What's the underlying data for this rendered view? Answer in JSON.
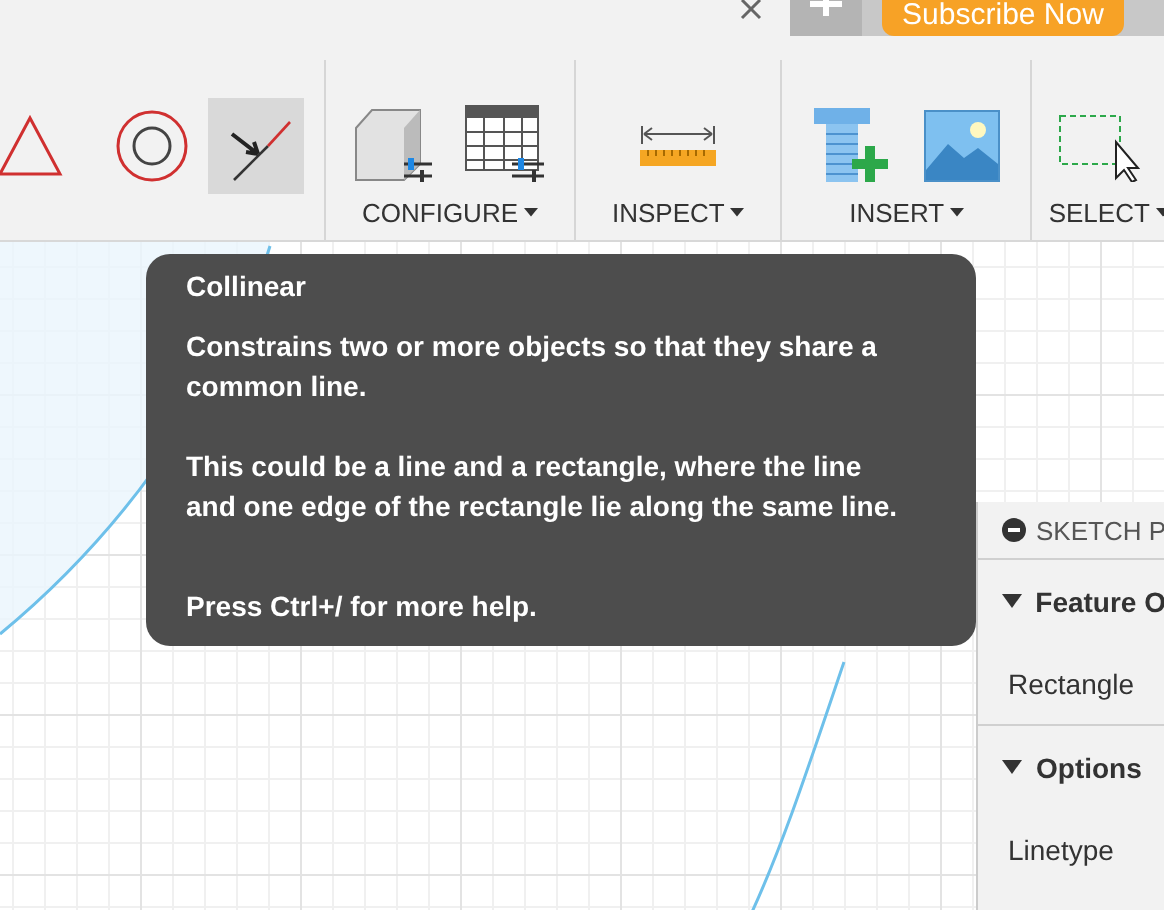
{
  "tab_strip": {
    "subscribe_button": "Subscribe Now"
  },
  "toolbar": {
    "groups": [
      {
        "tools": [
          {
            "kind": "triangle",
            "selected": false
          },
          {
            "kind": "circle",
            "selected": false
          },
          {
            "kind": "collinear",
            "selected": true
          }
        ]
      },
      {
        "label": "CONFIGURE",
        "tools": [
          {
            "kind": "box",
            "selected": false
          },
          {
            "kind": "table",
            "selected": false
          }
        ]
      },
      {
        "label": "INSPECT",
        "tools": [
          {
            "kind": "ruler",
            "selected": false
          }
        ]
      },
      {
        "label": "INSERT",
        "tools": [
          {
            "kind": "bolt",
            "selected": false
          },
          {
            "kind": "image",
            "selected": false
          }
        ]
      },
      {
        "label": "SELECT",
        "tools": [
          {
            "kind": "select",
            "selected": false
          }
        ]
      }
    ]
  },
  "tooltip": {
    "title": "Collinear",
    "paragraphs": [
      "Constrains two or more objects so that they share a common line.",
      "This could be a line and a rectangle, where the line and one edge of the rectangle lie along the same line.",
      "Press Ctrl+/ for more help."
    ]
  },
  "palette": {
    "title": "SKETCH P",
    "sections": [
      {
        "title": "Feature O",
        "expanded": true,
        "rows": [
          "Rectangle"
        ]
      },
      {
        "title": "Options",
        "expanded": true,
        "rows": [
          "Linetype"
        ]
      }
    ]
  }
}
